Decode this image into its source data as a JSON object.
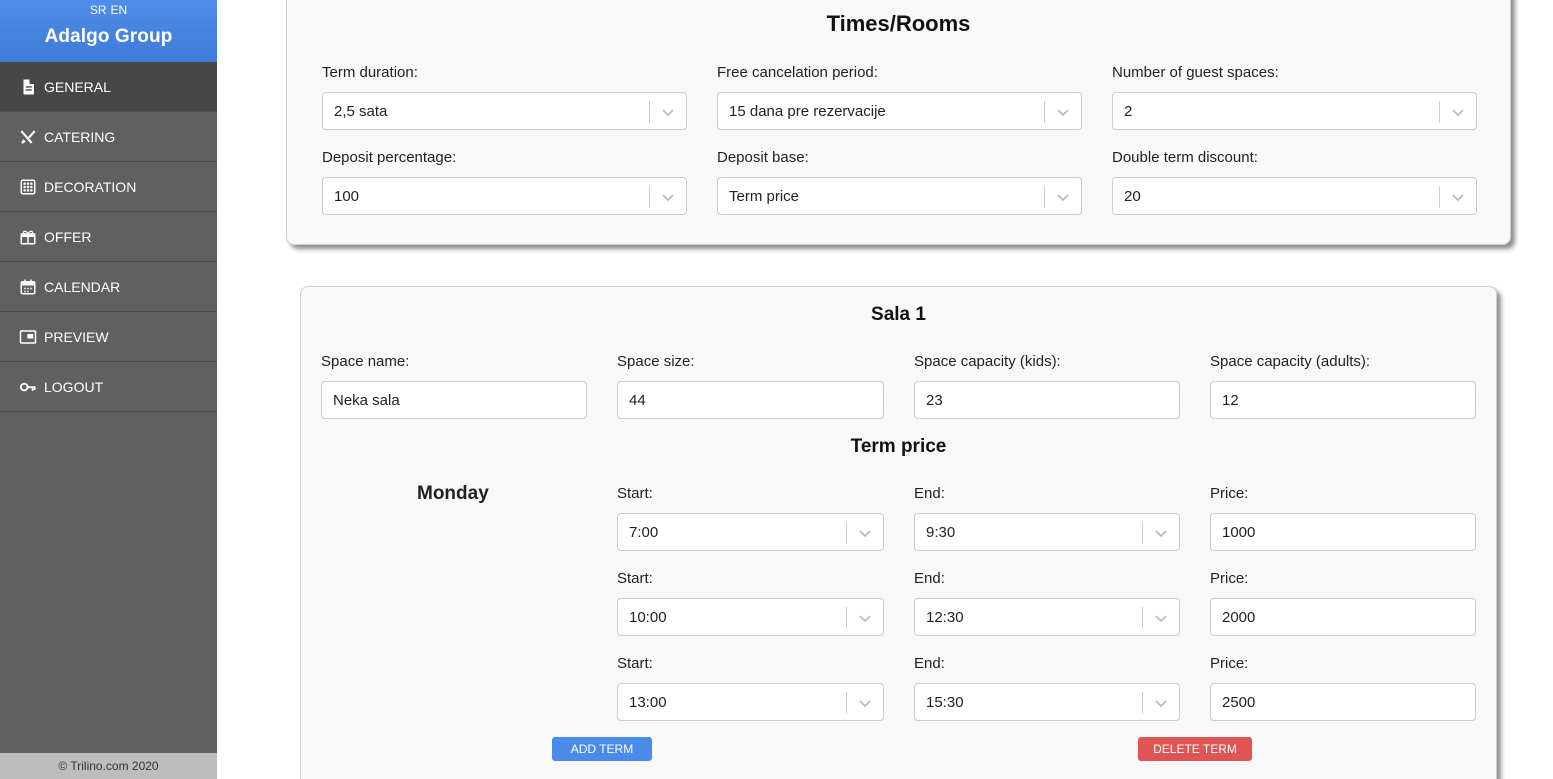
{
  "sidebar": {
    "lang_sr": "SR",
    "lang_en": "EN",
    "brand": "Adalgo Group",
    "items": [
      {
        "label": "GENERAL",
        "icon": "document-icon"
      },
      {
        "label": "CATERING",
        "icon": "utensils-icon"
      },
      {
        "label": "DECORATION",
        "icon": "grid-icon"
      },
      {
        "label": "OFFER",
        "icon": "gift-icon"
      },
      {
        "label": "CALENDAR",
        "icon": "calendar-icon"
      },
      {
        "label": "PREVIEW",
        "icon": "preview-icon"
      },
      {
        "label": "LOGOUT",
        "icon": "key-icon"
      }
    ],
    "active": "GENERAL",
    "footer": "© Trilino.com 2020"
  },
  "times_rooms": {
    "title": "Times/Rooms",
    "term_duration": {
      "label": "Term duration:",
      "value": "2,5 sata"
    },
    "free_cancelation": {
      "label": "Free cancelation period:",
      "value": "15 dana pre rezervacije"
    },
    "guest_spaces": {
      "label": "Number of guest spaces:",
      "value": "2"
    },
    "deposit_percentage": {
      "label": "Deposit percentage:",
      "value": "100"
    },
    "deposit_base": {
      "label": "Deposit base:",
      "value": "Term price"
    },
    "double_discount": {
      "label": "Double term discount:",
      "value": "20"
    }
  },
  "room": {
    "title": "Sala 1",
    "space_name": {
      "label": "Space name:",
      "value": "Neka sala"
    },
    "space_size": {
      "label": "Space size:",
      "value": "44"
    },
    "capacity_kids": {
      "label": "Space capacity (kids):",
      "value": "23"
    },
    "capacity_adults": {
      "label": "Space capacity (adults):",
      "value": "12"
    },
    "term_price_title": "Term price",
    "day": "Monday",
    "start_label": "Start:",
    "end_label": "End:",
    "price_label": "Price:",
    "terms": [
      {
        "start": "7:00",
        "end": "9:30",
        "price": "1000"
      },
      {
        "start": "10:00",
        "end": "12:30",
        "price": "2000"
      },
      {
        "start": "13:00",
        "end": "15:30",
        "price": "2500"
      }
    ],
    "add_term": "ADD TERM",
    "delete_term": "DELETE TERM"
  },
  "colors": {
    "sidebar_bg": "#606060",
    "header_blue": "#4f8de8",
    "add_button": "#4a8bea",
    "delete_button": "#df5454"
  }
}
